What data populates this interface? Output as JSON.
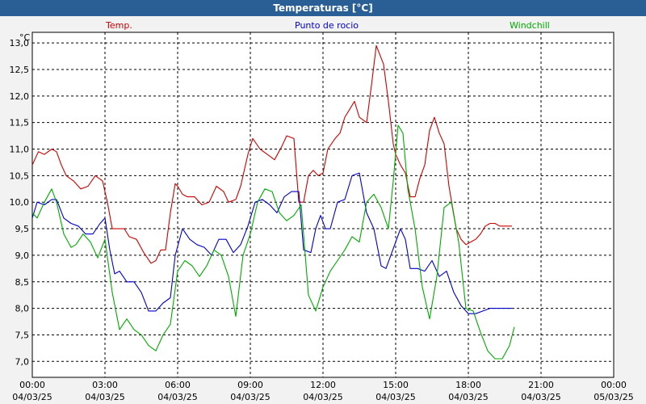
{
  "window": {
    "title": "Temperaturas [°C]"
  },
  "chart_data": {
    "type": "line",
    "title": "Temperaturas [°C]",
    "unit_label": "°C",
    "ylim": [
      6.7,
      13.2
    ],
    "y_ticks": [
      "13,0",
      "12,5",
      "12,0",
      "11,5",
      "11,0",
      "10,5",
      "10,0",
      "9,5",
      "9,0",
      "8,5",
      "8,0",
      "7,5",
      "7,0"
    ],
    "y_tick_values": [
      13.0,
      12.5,
      12.0,
      11.5,
      11.0,
      10.5,
      10.0,
      9.5,
      9.0,
      8.5,
      8.0,
      7.5,
      7.0
    ],
    "x_ticks": [
      {
        "time": "00:00",
        "date": "04/03/25"
      },
      {
        "time": "03:00",
        "date": "04/03/25"
      },
      {
        "time": "06:00",
        "date": "04/03/25"
      },
      {
        "time": "09:00",
        "date": "04/03/25"
      },
      {
        "time": "12:00",
        "date": "04/03/25"
      },
      {
        "time": "15:00",
        "date": "04/03/25"
      },
      {
        "time": "18:00",
        "date": "04/03/25"
      },
      {
        "time": "21:00",
        "date": "04/03/25"
      },
      {
        "time": "00:00",
        "date": "05/03/25"
      }
    ],
    "x_range_hours": [
      0,
      24
    ],
    "grid": true,
    "series": [
      {
        "name": "Temp.",
        "color": "#cc0000",
        "x": [
          0,
          0.25,
          0.5,
          0.8,
          1,
          1.2,
          1.4,
          1.7,
          2,
          2.3,
          2.6,
          2.9,
          3.1,
          3.3,
          3.5,
          3.8,
          4,
          4.3,
          4.6,
          4.9,
          5.1,
          5.3,
          5.5,
          5.7,
          5.9,
          6,
          6.2,
          6.4,
          6.7,
          7,
          7.3,
          7.6,
          7.9,
          8.1,
          8.4,
          8.6,
          8.9,
          9.1,
          9.4,
          9.7,
          10,
          10.3,
          10.5,
          10.8,
          11,
          11.2,
          11.4,
          11.6,
          11.8,
          12,
          12.2,
          12.5,
          12.7,
          12.9,
          13.1,
          13.3,
          13.5,
          13.8,
          14,
          14.2,
          14.5,
          14.7,
          14.9,
          15,
          15.2,
          15.4,
          15.6,
          15.8,
          16,
          16.2,
          16.4,
          16.6,
          16.8,
          17,
          17.2,
          17.5,
          17.7,
          17.9,
          18.1,
          18.3,
          18.5,
          18.7,
          18.9,
          19.1,
          19.3,
          19.6,
          19.8
        ],
        "y": [
          10.7,
          10.95,
          10.9,
          11.0,
          10.95,
          10.7,
          10.5,
          10.4,
          10.25,
          10.3,
          10.5,
          10.4,
          10.0,
          9.5,
          9.5,
          9.5,
          9.35,
          9.3,
          9.05,
          8.85,
          8.9,
          9.1,
          9.1,
          9.8,
          10.35,
          10.3,
          10.15,
          10.1,
          10.1,
          9.95,
          10.0,
          10.3,
          10.2,
          10.0,
          10.05,
          10.3,
          10.9,
          11.2,
          11.0,
          10.9,
          10.8,
          11.05,
          11.25,
          11.2,
          10.0,
          10.0,
          10.5,
          10.6,
          10.5,
          10.55,
          11.0,
          11.2,
          11.3,
          11.6,
          11.75,
          11.9,
          11.6,
          11.5,
          12.2,
          12.95,
          12.6,
          11.9,
          11.1,
          10.9,
          10.7,
          10.55,
          10.1,
          10.1,
          10.45,
          10.7,
          11.35,
          11.6,
          11.3,
          11.1,
          10.3,
          9.5,
          9.3,
          9.2,
          9.25,
          9.3,
          9.4,
          9.55,
          9.6,
          9.6,
          9.55,
          9.55,
          9.55
        ]
      },
      {
        "name": "Punto de rocio",
        "color": "#0000cc",
        "x": [
          0,
          0.2,
          0.5,
          0.8,
          1,
          1.3,
          1.6,
          1.9,
          2.2,
          2.5,
          2.8,
          3,
          3.2,
          3.4,
          3.6,
          3.9,
          4.2,
          4.5,
          4.8,
          5.1,
          5.4,
          5.7,
          5.9,
          6.2,
          6.5,
          6.8,
          7.1,
          7.4,
          7.7,
          8,
          8.3,
          8.6,
          8.9,
          9.2,
          9.5,
          9.8,
          10.1,
          10.4,
          10.7,
          11,
          11.2,
          11.5,
          11.7,
          11.9,
          12.1,
          12.3,
          12.6,
          12.9,
          13.2,
          13.5,
          13.8,
          14.1,
          14.4,
          14.6,
          14.8,
          15,
          15.2,
          15.4,
          15.6,
          15.9,
          16.2,
          16.5,
          16.8,
          17.1,
          17.4,
          17.7,
          18,
          18.3,
          18.6,
          18.9,
          19.2,
          19.5,
          19.8
        ],
        "y": [
          9.7,
          10.0,
          9.95,
          10.05,
          10.05,
          9.7,
          9.6,
          9.55,
          9.4,
          9.4,
          9.6,
          9.7,
          9.1,
          8.65,
          8.7,
          8.5,
          8.5,
          8.3,
          7.95,
          7.95,
          8.1,
          8.2,
          9.0,
          9.5,
          9.3,
          9.2,
          9.15,
          9.0,
          9.3,
          9.3,
          9.05,
          9.2,
          9.55,
          10.0,
          10.05,
          9.95,
          9.8,
          10.1,
          10.2,
          10.2,
          9.1,
          9.05,
          9.5,
          9.75,
          9.5,
          9.5,
          10.0,
          10.05,
          10.5,
          10.55,
          9.8,
          9.5,
          8.8,
          8.75,
          9.0,
          9.25,
          9.5,
          9.3,
          8.75,
          8.75,
          8.7,
          8.9,
          8.6,
          8.7,
          8.3,
          8.05,
          7.9,
          7.9,
          7.95,
          8.0,
          8.0,
          8.0,
          8.0
        ]
      },
      {
        "name": "Windchill",
        "color": "#00aa00",
        "x": [
          0,
          0.2,
          0.5,
          0.8,
          1,
          1.3,
          1.6,
          1.8,
          2.1,
          2.4,
          2.7,
          3,
          3.3,
          3.6,
          3.9,
          4.2,
          4.5,
          4.8,
          5.1,
          5.4,
          5.7,
          6,
          6.3,
          6.6,
          6.9,
          7.2,
          7.5,
          7.8,
          8.1,
          8.4,
          8.7,
          9,
          9.3,
          9.6,
          9.9,
          10.2,
          10.5,
          10.8,
          11.1,
          11.4,
          11.7,
          12,
          12.3,
          12.6,
          12.9,
          13.2,
          13.5,
          13.8,
          14.1,
          14.4,
          14.7,
          14.9,
          15.1,
          15.3,
          15.5,
          15.8,
          16.1,
          16.4,
          16.7,
          17,
          17.3,
          17.6,
          17.9,
          18.2,
          18.5,
          18.8,
          19.1,
          19.4,
          19.7,
          19.9
        ],
        "y": [
          9.8,
          9.7,
          10.0,
          10.25,
          10.0,
          9.4,
          9.15,
          9.2,
          9.4,
          9.25,
          8.95,
          9.3,
          8.3,
          7.6,
          7.8,
          7.6,
          7.5,
          7.3,
          7.2,
          7.5,
          7.7,
          8.7,
          8.9,
          8.8,
          8.6,
          8.8,
          9.1,
          9.0,
          8.6,
          7.85,
          9.0,
          9.4,
          10.0,
          10.25,
          10.2,
          9.8,
          9.65,
          9.75,
          9.95,
          8.25,
          7.95,
          8.4,
          8.7,
          8.9,
          9.1,
          9.35,
          9.25,
          10.0,
          10.15,
          9.9,
          9.5,
          10.4,
          11.45,
          11.3,
          10.25,
          9.5,
          8.4,
          7.8,
          8.6,
          9.9,
          10.0,
          9.25,
          8.0,
          7.95,
          7.55,
          7.2,
          7.05,
          7.05,
          7.3,
          7.65
        ]
      }
    ]
  }
}
